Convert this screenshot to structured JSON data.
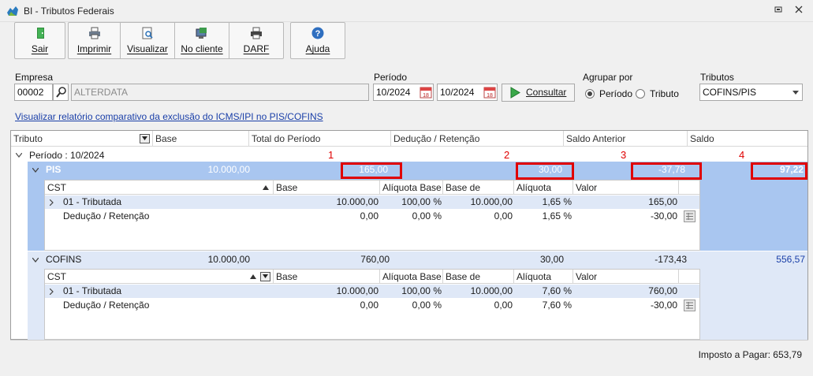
{
  "window": {
    "title": "BI - Tributos Federais"
  },
  "toolbar": {
    "sair": "Sair",
    "imprimir": "Imprimir",
    "visualizar": "Visualizar",
    "no_cliente": "No cliente",
    "darf": "DARF",
    "ajuda": "Ajuda"
  },
  "form": {
    "empresa_label": "Empresa",
    "empresa_code": "00002",
    "empresa_name": "ALTERDATA",
    "periodo_label": "Período",
    "periodo_inicio": "10/2024",
    "periodo_fim": "10/2024",
    "consultar": "Consultar",
    "agrupar_label": "Agrupar por",
    "opt_periodo": "Período",
    "opt_tributo": "Tributo",
    "tributos_label": "Tributos",
    "tributos_value": "COFINS/PIS",
    "link": "Visualizar relatório comparativo da exclusão do ICMS/IPI no PIS/COFINS"
  },
  "grid": {
    "headers": [
      "Tributo",
      "Base",
      "Total do Período",
      "Dedução / Retenção",
      "Saldo Anterior",
      "Saldo"
    ],
    "group": "Período : 10/2024",
    "markers": [
      "1",
      "2",
      "3",
      "4"
    ],
    "sub_headers": [
      "CST",
      "Base",
      "Alíquota Base",
      "Base de Cálculo",
      "Alíquota",
      "Valor"
    ],
    "tributos": [
      {
        "name": "PIS",
        "base": "10.000,00",
        "total": "165,00",
        "deducao": "30,00",
        "saldo_anterior": "-37,78",
        "saldo": "97,22",
        "rows": [
          {
            "cst": "01 - Tributada",
            "base": "10.000,00",
            "aliq_base": "100,00 %",
            "base_calc": "10.000,00",
            "aliq": "1,65 %",
            "valor": "165,00"
          },
          {
            "cst": "Dedução / Retenção",
            "base": "0,00",
            "aliq_base": "0,00 %",
            "base_calc": "0,00",
            "aliq": "1,65 %",
            "valor": "-30,00"
          }
        ]
      },
      {
        "name": "COFINS",
        "base": "10.000,00",
        "total": "760,00",
        "deducao": "30,00",
        "saldo_anterior": "-173,43",
        "saldo": "556,57",
        "rows": [
          {
            "cst": "01 - Tributada",
            "base": "10.000,00",
            "aliq_base": "100,00 %",
            "base_calc": "10.000,00",
            "aliq": "7,60 %",
            "valor": "760,00"
          },
          {
            "cst": "Dedução / Retenção",
            "base": "0,00",
            "aliq_base": "0,00 %",
            "base_calc": "0,00",
            "aliq": "7,60 %",
            "valor": "-30,00"
          }
        ]
      }
    ]
  },
  "status": {
    "imposto": "Imposto a Pagar: 653,79"
  },
  "colors": {
    "highlight": "#a9c6f0",
    "marker_red": "#e00000",
    "link_blue": "#1a3fa8"
  }
}
